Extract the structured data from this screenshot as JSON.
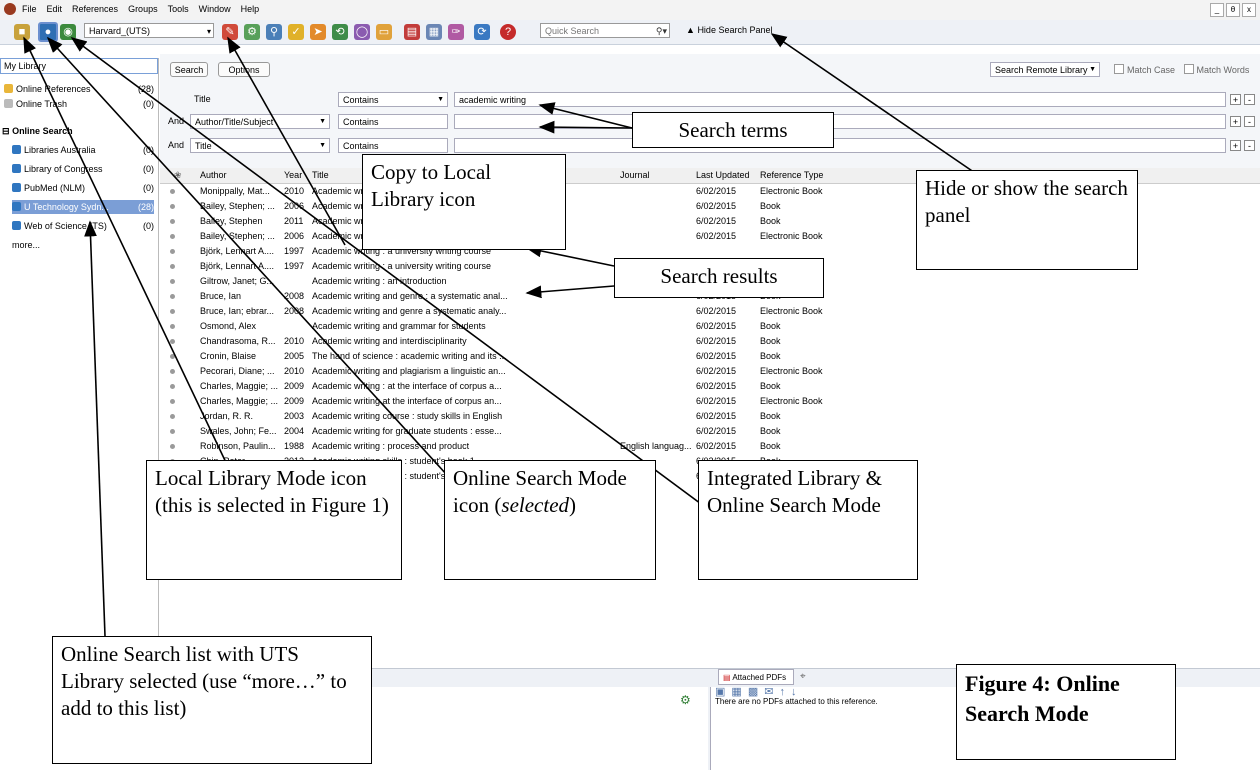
{
  "menu": {
    "items": [
      "File",
      "Edit",
      "References",
      "Groups",
      "Tools",
      "Window",
      "Help"
    ],
    "win": [
      "_",
      "θ",
      "x"
    ]
  },
  "toolbar": {
    "style": "Harvard_(UTS)",
    "quick_search": "Quick Search",
    "hide_panel": "Hide Search Panel"
  },
  "sidebar": {
    "my_library": "My Library",
    "online_refs": {
      "label": "Online References",
      "count": "(28)"
    },
    "online_trash": {
      "label": "Online Trash",
      "count": "(0)"
    },
    "online_search": "Online Search",
    "items": [
      {
        "label": "Libraries Australia",
        "count": "(0)"
      },
      {
        "label": "Library of Congress",
        "count": "(0)"
      },
      {
        "label": "PubMed (NLM)",
        "count": "(0)"
      },
      {
        "label": "U Technology Sydn...",
        "count": "(28)"
      },
      {
        "label": "Web of Science (TS)",
        "count": "(0)"
      }
    ],
    "more": "more..."
  },
  "search": {
    "search_btn": "Search",
    "options_btn": "Options",
    "remote": "Search Remote Library",
    "match_case": "Match Case",
    "match_words": "Match Words",
    "rows": [
      {
        "bool": "",
        "field": "Title",
        "op": "Contains",
        "term": "academic writing"
      },
      {
        "bool": "And",
        "field": "Author/Title/Subject",
        "op": "Contains",
        "term": ""
      },
      {
        "bool": "And",
        "field": "Title",
        "op": "Contains",
        "term": ""
      }
    ]
  },
  "table": {
    "headers": [
      "Author",
      "Year",
      "Title",
      "Journal",
      "Last Updated",
      "Reference Type"
    ],
    "rows": [
      [
        "Monippally, Mat...",
        "2010",
        "Academic writing...",
        "",
        "6/02/2015",
        "Electronic Book"
      ],
      [
        "Bailey, Stephen; ...",
        "2006",
        "Academic writing...",
        "",
        "6/02/2015",
        "Book"
      ],
      [
        "Bailey, Stephen",
        "2011",
        "Academic writing : a handbook for internation...",
        "",
        "6/02/2015",
        "Book"
      ],
      [
        "Bailey, Stephen; ...",
        "2006",
        "Academic writing a handbook for international...",
        "",
        "6/02/2015",
        "Electronic Book"
      ],
      [
        "Björk, Lennart A....",
        "1997",
        "Academic writing : a university writing course",
        "",
        "",
        "",
        ""
      ],
      [
        "Björk, Lennart A....",
        "1997",
        "Academic writing : a university writing course",
        "",
        "",
        "",
        ""
      ],
      [
        "Giltrow, Janet; G...",
        "",
        "Academic writing : an introduction",
        "",
        "",
        "",
        ""
      ],
      [
        "Bruce, Ian",
        "2008",
        "Academic writing and genre : a systematic anal...",
        "",
        "6/02/2015",
        "Book"
      ],
      [
        "Bruce, Ian; ebrar...",
        "2008",
        "Academic writing and genre a systematic analy...",
        "",
        "6/02/2015",
        "Electronic Book"
      ],
      [
        "Osmond, Alex",
        "",
        "Academic writing and grammar for students",
        "",
        "6/02/2015",
        "Book"
      ],
      [
        "Chandrasoma, R...",
        "2010",
        "Academic writing and interdisciplinarity",
        "",
        "6/02/2015",
        "Book"
      ],
      [
        "Cronin, Blaise",
        "2005",
        "The hand of science : academic writing and its ...",
        "",
        "6/02/2015",
        "Book"
      ],
      [
        "Pecorari, Diane; ...",
        "2010",
        "Academic writing and plagiarism a linguistic an...",
        "",
        "6/02/2015",
        "Electronic Book"
      ],
      [
        "Charles, Maggie; ...",
        "2009",
        "Academic writing : at the interface of corpus a...",
        "",
        "6/02/2015",
        "Book"
      ],
      [
        "Charles, Maggie; ...",
        "2009",
        "Academic writing at the interface of corpus an...",
        "",
        "6/02/2015",
        "Electronic Book"
      ],
      [
        "Jordan, R. R.",
        "2003",
        "Academic writing course : study skills in English",
        "",
        "6/02/2015",
        "Book"
      ],
      [
        "Swales, John; Fe...",
        "2004",
        "Academic writing for graduate students : esse...",
        "",
        "6/02/2015",
        "Book"
      ],
      [
        "Robinson, Paulin...",
        "1988",
        "Academic writing : process and product",
        "English languag...",
        "6/02/2015",
        "Book"
      ],
      [
        "Chin, Peter",
        "2012",
        "Academic writing skills : student's book 1",
        "",
        "6/02/2015",
        "Book"
      ],
      [
        "Chin, Peter",
        "2012",
        "Academic writing skills : student's book 2",
        "",
        "6/02/2015",
        "Book"
      ]
    ]
  },
  "bottom": {
    "pdf_tab": "Attached PDFs",
    "pdf_msg": "There are no PDFs attached to this reference."
  },
  "callouts": {
    "copy": "Copy to Local Library icon",
    "terms": "Search terms",
    "hide": "Hide or show the search panel",
    "results": "Search results",
    "local": "Local Library Mode icon (this is selected in Figure 1)",
    "online": "Online Search Mode icon (selected)",
    "integrated": "Integrated Library & Online Search Mode",
    "list": "Online Search list with UTS Library selected (use “more…” to add to this list)",
    "figure": "Figure 4: Online Search Mode"
  }
}
